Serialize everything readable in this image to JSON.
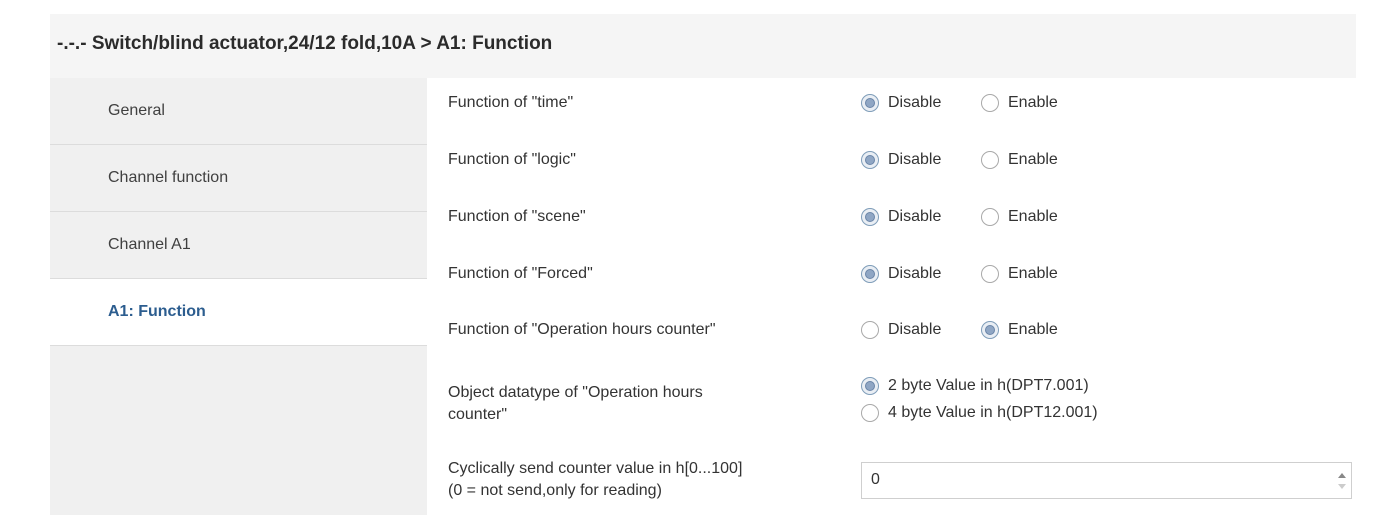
{
  "header": {
    "title": "-.-.- Switch/blind actuator,24/12 fold,10A > A1: Function"
  },
  "sidebar": {
    "items": [
      {
        "label": "General",
        "active": false
      },
      {
        "label": "Channel function",
        "active": false
      },
      {
        "label": "Channel A1",
        "active": false
      },
      {
        "label": "A1: Function",
        "active": true
      }
    ]
  },
  "params": {
    "time": {
      "label": "Function of \"time\"",
      "options": [
        "Disable",
        "Enable"
      ],
      "selected": "Disable"
    },
    "logic": {
      "label": "Function of \"logic\"",
      "options": [
        "Disable",
        "Enable"
      ],
      "selected": "Disable"
    },
    "scene": {
      "label": "Function of \"scene\"",
      "options": [
        "Disable",
        "Enable"
      ],
      "selected": "Disable"
    },
    "forced": {
      "label": "Function of \"Forced\"",
      "options": [
        "Disable",
        "Enable"
      ],
      "selected": "Disable"
    },
    "hours_counter": {
      "label": "Function of \"Operation hours counter\"",
      "options": [
        "Disable",
        "Enable"
      ],
      "selected": "Enable"
    },
    "datatype": {
      "label_line1": "Object datatype of \"Operation hours",
      "label_line2": "counter\"",
      "options": [
        "2 byte Value in h(DPT7.001)",
        "4 byte Value in h(DPT12.001)"
      ],
      "selected": "2 byte Value in h(DPT7.001)"
    },
    "cyclic": {
      "label_line1": "Cyclically send counter value in h[0...100]",
      "label_line2": "(0 = not send,only for reading)",
      "value": "0"
    }
  },
  "icons": {
    "radio_checked": "radio-checked-icon",
    "radio_unchecked": "radio-unchecked-icon",
    "spin_up": "spin-up-icon",
    "spin_down": "spin-down-icon"
  },
  "colors": {
    "active_sidebar_text": "#2c5d8f",
    "sidebar_bg": "#f0f0f0",
    "header_bg": "#f5f5f5"
  }
}
